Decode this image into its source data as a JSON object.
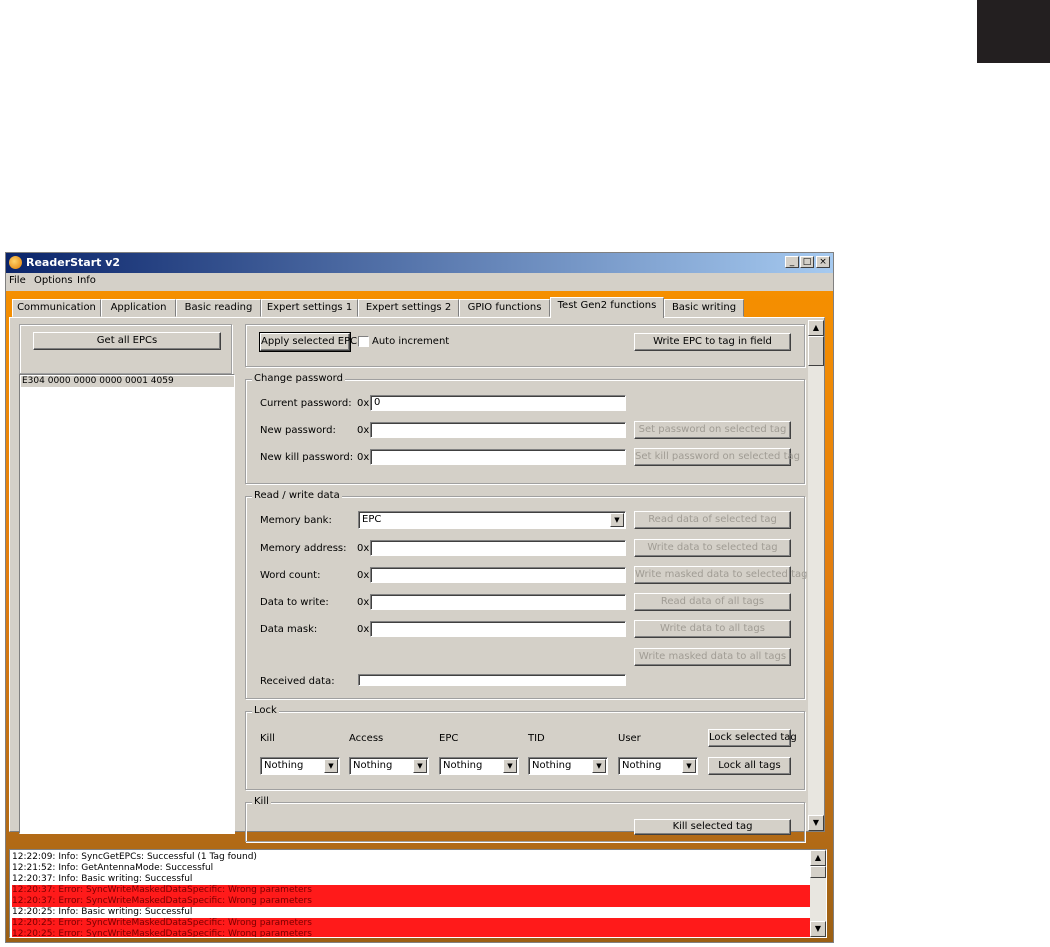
{
  "window": {
    "title": "ReaderStart v2",
    "buttons": {
      "minimize": "_",
      "maximize": "□",
      "close": "×"
    }
  },
  "menu": [
    "File",
    "Options",
    "Info"
  ],
  "tabs": [
    {
      "label": "Communication"
    },
    {
      "label": "Application"
    },
    {
      "label": "Basic reading"
    },
    {
      "label": "Expert settings 1"
    },
    {
      "label": "Expert settings 2"
    },
    {
      "label": "GPIO functions"
    },
    {
      "label": "Test Gen2 functions",
      "active": true
    },
    {
      "label": "Basic writing"
    }
  ],
  "left": {
    "get_all_epcs": "Get all EPCs",
    "epc_list": [
      "E304 0000 0000 0000 0001 4059"
    ]
  },
  "top": {
    "apply_selected_epc": "Apply selected EPC",
    "auto_increment_label": "Auto increment",
    "auto_increment_checked": false,
    "write_epc": "Write EPC to tag in field"
  },
  "change_password": {
    "title": "Change password",
    "current_label": "Current password:",
    "current_value": "0",
    "new_label": "New password:",
    "new_value": "",
    "kill_label": "New kill password:",
    "kill_value": "",
    "hex_prefix": "0x",
    "set_password_btn": "Set password on selected tag",
    "set_kill_btn": "Set kill password on selected tag"
  },
  "read_write": {
    "title": "Read / write data",
    "memory_bank_label": "Memory bank:",
    "memory_bank_value": "EPC",
    "memory_address_label": "Memory address:",
    "word_count_label": "Word count:",
    "data_to_write_label": "Data to write:",
    "data_mask_label": "Data mask:",
    "received_data_label": "Received data:",
    "hex_prefix": "0x",
    "btn_read_selected": "Read data of selected tag",
    "btn_write_selected": "Write data to selected tag",
    "btn_write_masked_selected": "Write masked data to selected tag",
    "btn_read_all": "Read data of all tags",
    "btn_write_all": "Write data to all tags",
    "btn_write_masked_all": "Write masked data to all tags"
  },
  "lock": {
    "title": "Lock",
    "columns": [
      "Kill",
      "Access",
      "EPC",
      "TID",
      "User"
    ],
    "values": [
      "Nothing",
      "Nothing",
      "Nothing",
      "Nothing",
      "Nothing"
    ],
    "lock_selected_btn": "Lock selected tag",
    "lock_all_btn": "Lock all tags"
  },
  "kill": {
    "title": "Kill",
    "kill_selected_btn": "Kill selected tag"
  },
  "log": [
    {
      "text": "12:22:09: Info: SyncGetEPCs: Successful (1 Tag found)",
      "error": false
    },
    {
      "text": "12:21:52: Info: GetAntennaMode: Successful",
      "error": false
    },
    {
      "text": "12:20:37: Info: Basic writing: Successful",
      "error": false
    },
    {
      "text": "12:20:37: Error: SyncWriteMaskedDataSpecific: Wrong parameters",
      "error": true
    },
    {
      "text": "12:20:37: Error: SyncWriteMaskedDataSpecific: Wrong parameters",
      "error": true
    },
    {
      "text": "12:20:25: Info: Basic writing: Successful",
      "error": false
    },
    {
      "text": "12:20:25: Error: SyncWriteMaskedDataSpecific: Wrong parameters",
      "error": true
    },
    {
      "text": "12:20:25: Error: SyncWriteMaskedDataSpecific: Wrong parameters",
      "error": true
    }
  ]
}
